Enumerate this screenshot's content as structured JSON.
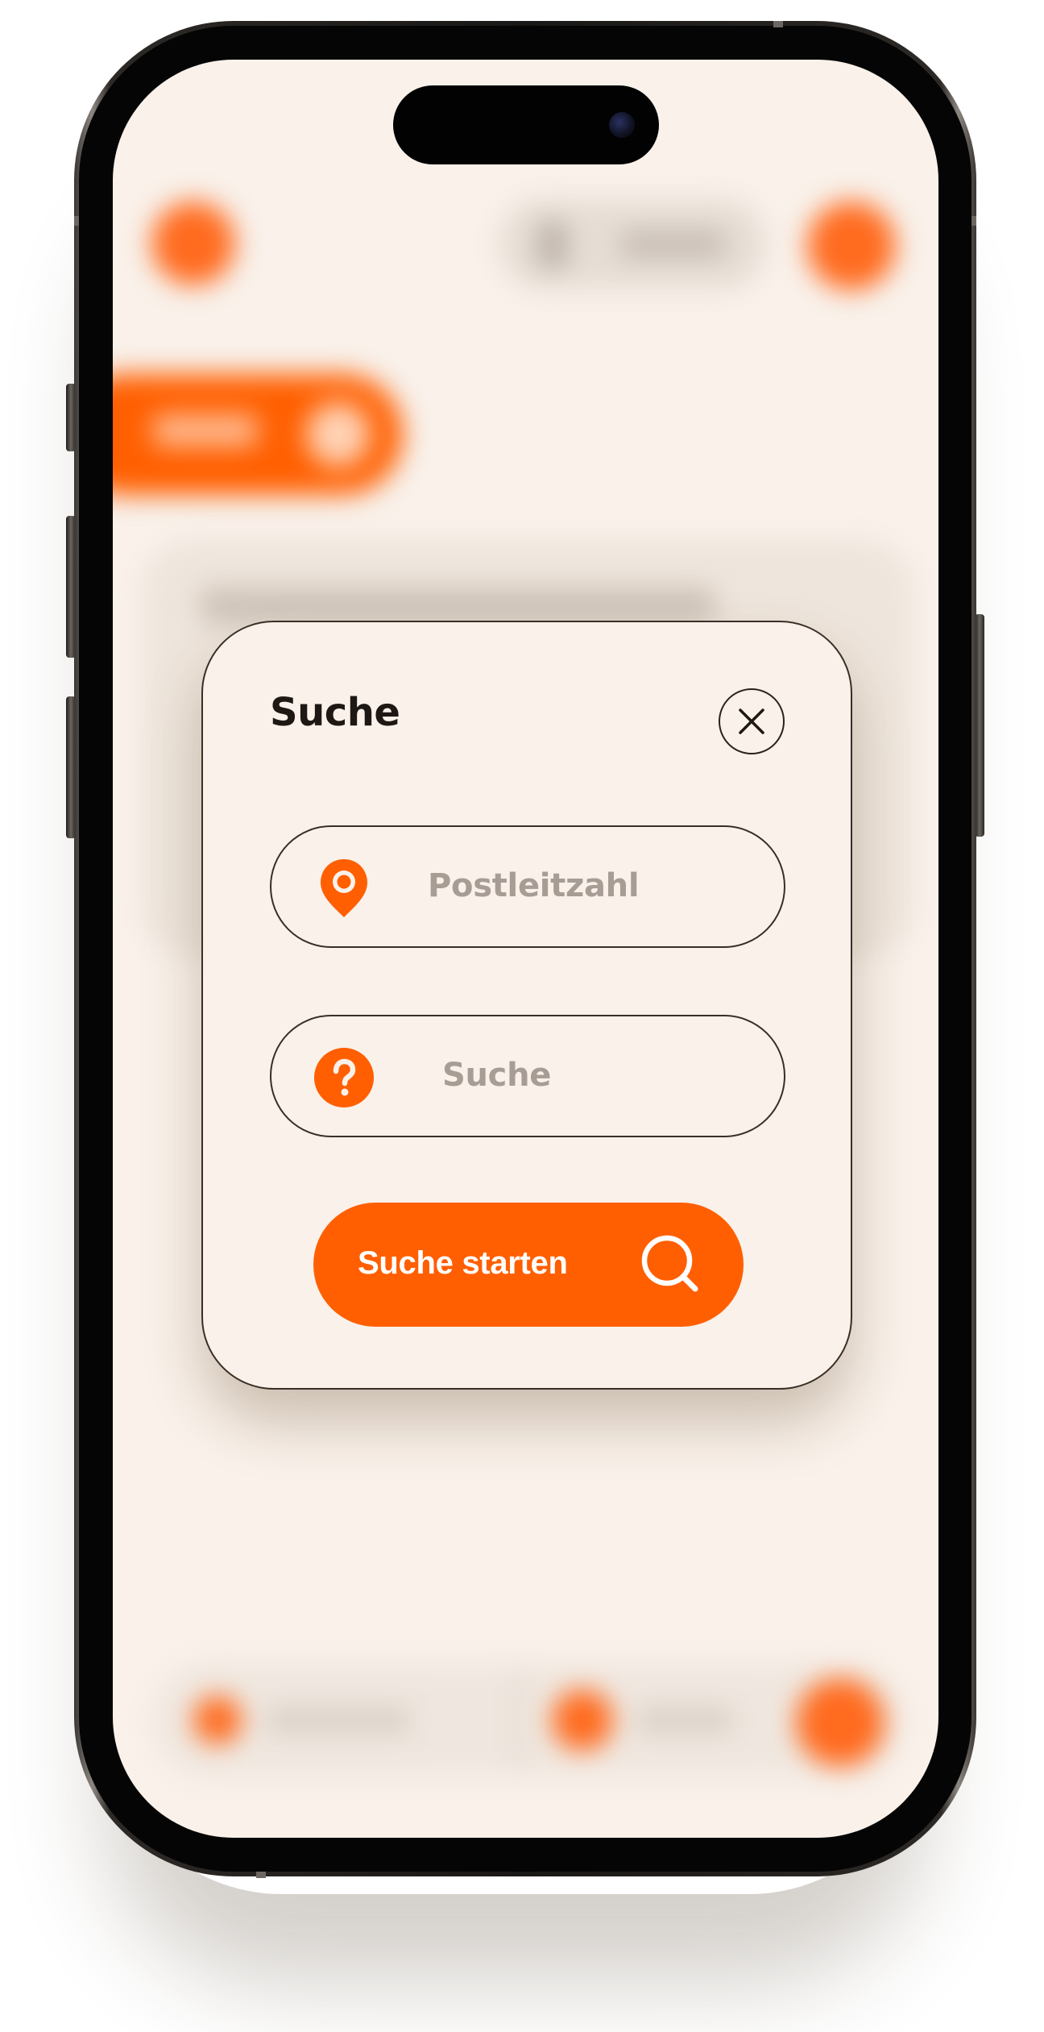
{
  "modal": {
    "title": "Suche",
    "zip_placeholder": "Postleitzahl",
    "query_placeholder": "Suche",
    "submit_label": "Suche starten"
  },
  "icons": {
    "close": "close-icon",
    "location": "location-pin-icon",
    "question": "question-icon",
    "search": "search-icon"
  },
  "colors": {
    "accent": "#ff5f00",
    "background": "#f9f1ea",
    "text": "#1e1814",
    "placeholder": "#a79d95",
    "border": "#3a2e26"
  }
}
